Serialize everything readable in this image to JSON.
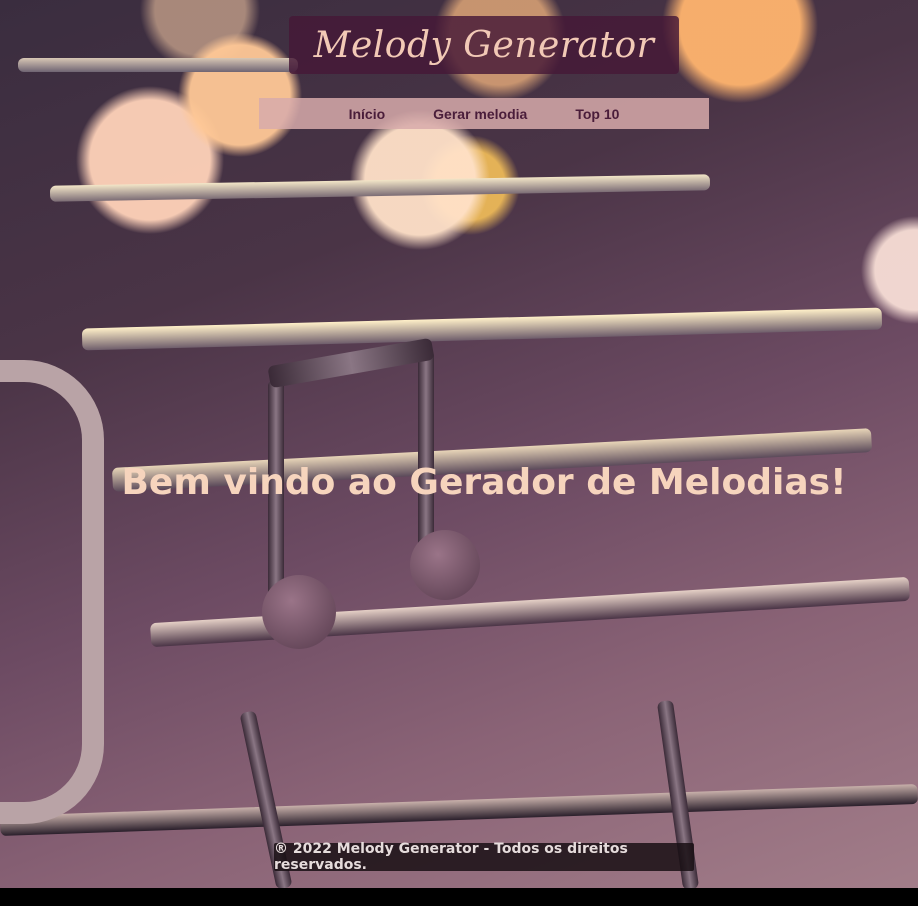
{
  "header": {
    "title": "Melody Generator"
  },
  "nav": {
    "items": [
      {
        "label": "Início"
      },
      {
        "label": "Gerar melodia"
      },
      {
        "label": "Top 10"
      }
    ]
  },
  "main": {
    "welcome": "Bem vindo ao Gerador de Melodias!"
  },
  "footer": {
    "text": "® 2022 Melody Generator - Todos os direitos reservados."
  },
  "colors": {
    "header_bg": "#46193a",
    "header_text": "#f2c9b6",
    "nav_bg": "#d7aaaa",
    "nav_text": "#4a1d3a",
    "welcome_text": "#f6d4bd",
    "footer_bg": "#190f14"
  }
}
